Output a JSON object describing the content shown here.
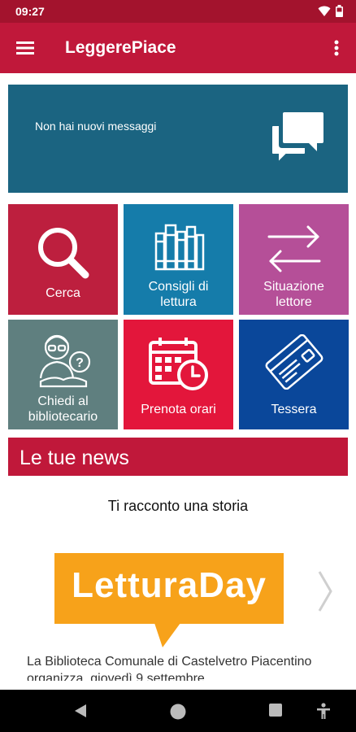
{
  "status_bar": {
    "time": "09:27"
  },
  "app_bar": {
    "title": "LeggerePiace"
  },
  "messages": {
    "text": "Non hai nuovi messaggi"
  },
  "tiles": [
    {
      "label": "Cerca",
      "color": "#bd1f3e",
      "icon": "search-icon"
    },
    {
      "label": "Consigli di lettura",
      "color": "#157caa",
      "icon": "books-icon"
    },
    {
      "label": "Situazione lettore",
      "color": "#b54f98",
      "icon": "swap-arrows-icon"
    },
    {
      "label": "Chiedi al bibliotecario",
      "color": "#5f7f7f",
      "icon": "librarian-icon"
    },
    {
      "label": "Prenota orari",
      "color": "#e3163b",
      "icon": "calendar-clock-icon"
    },
    {
      "label": "Tessera",
      "color": "#0a479a",
      "icon": "card-icon"
    }
  ],
  "news": {
    "header": "Le tue news",
    "story_title": "Ti racconto una storia",
    "banner_text": "LetturaDay",
    "article_text": "La Biblioteca Comunale di Castelvetro Piacentino organizza, giovedì 9 settembre"
  },
  "colors": {
    "primary": "#c0183a",
    "status": "#a3132d",
    "message_bg": "#1b6481",
    "banner": "#f7a21a"
  }
}
